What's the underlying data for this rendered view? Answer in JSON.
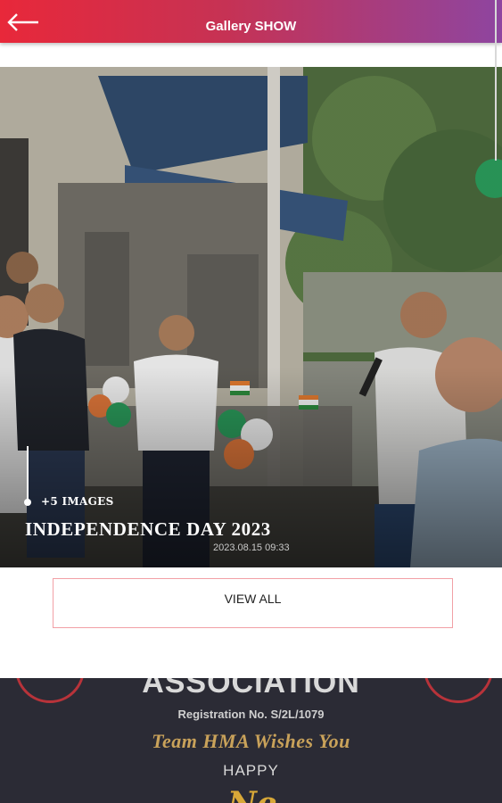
{
  "header": {
    "title": "Gallery SHOW",
    "back_icon": "arrow-left-icon"
  },
  "gallery": {
    "image_count_label": "+5 IMAGES",
    "event_title": "INDEPENDENCE DAY 2023",
    "event_date": "2023.08.15 09:33",
    "view_all_label": "VIEW ALL"
  },
  "banner": {
    "association": "ASSOCIATION",
    "registration": "Registration No.  S/2L/1079",
    "wishes": "Team HMA Wishes You",
    "happy": "HAPPY",
    "new": "Ne"
  },
  "colors": {
    "header_gradient_start": "#e8283a",
    "header_gradient_end": "#8e45a0",
    "view_all_border": "#f2a0a6",
    "banner_bg": "#2b2b35",
    "wishes_gold": "#c9a25a"
  }
}
